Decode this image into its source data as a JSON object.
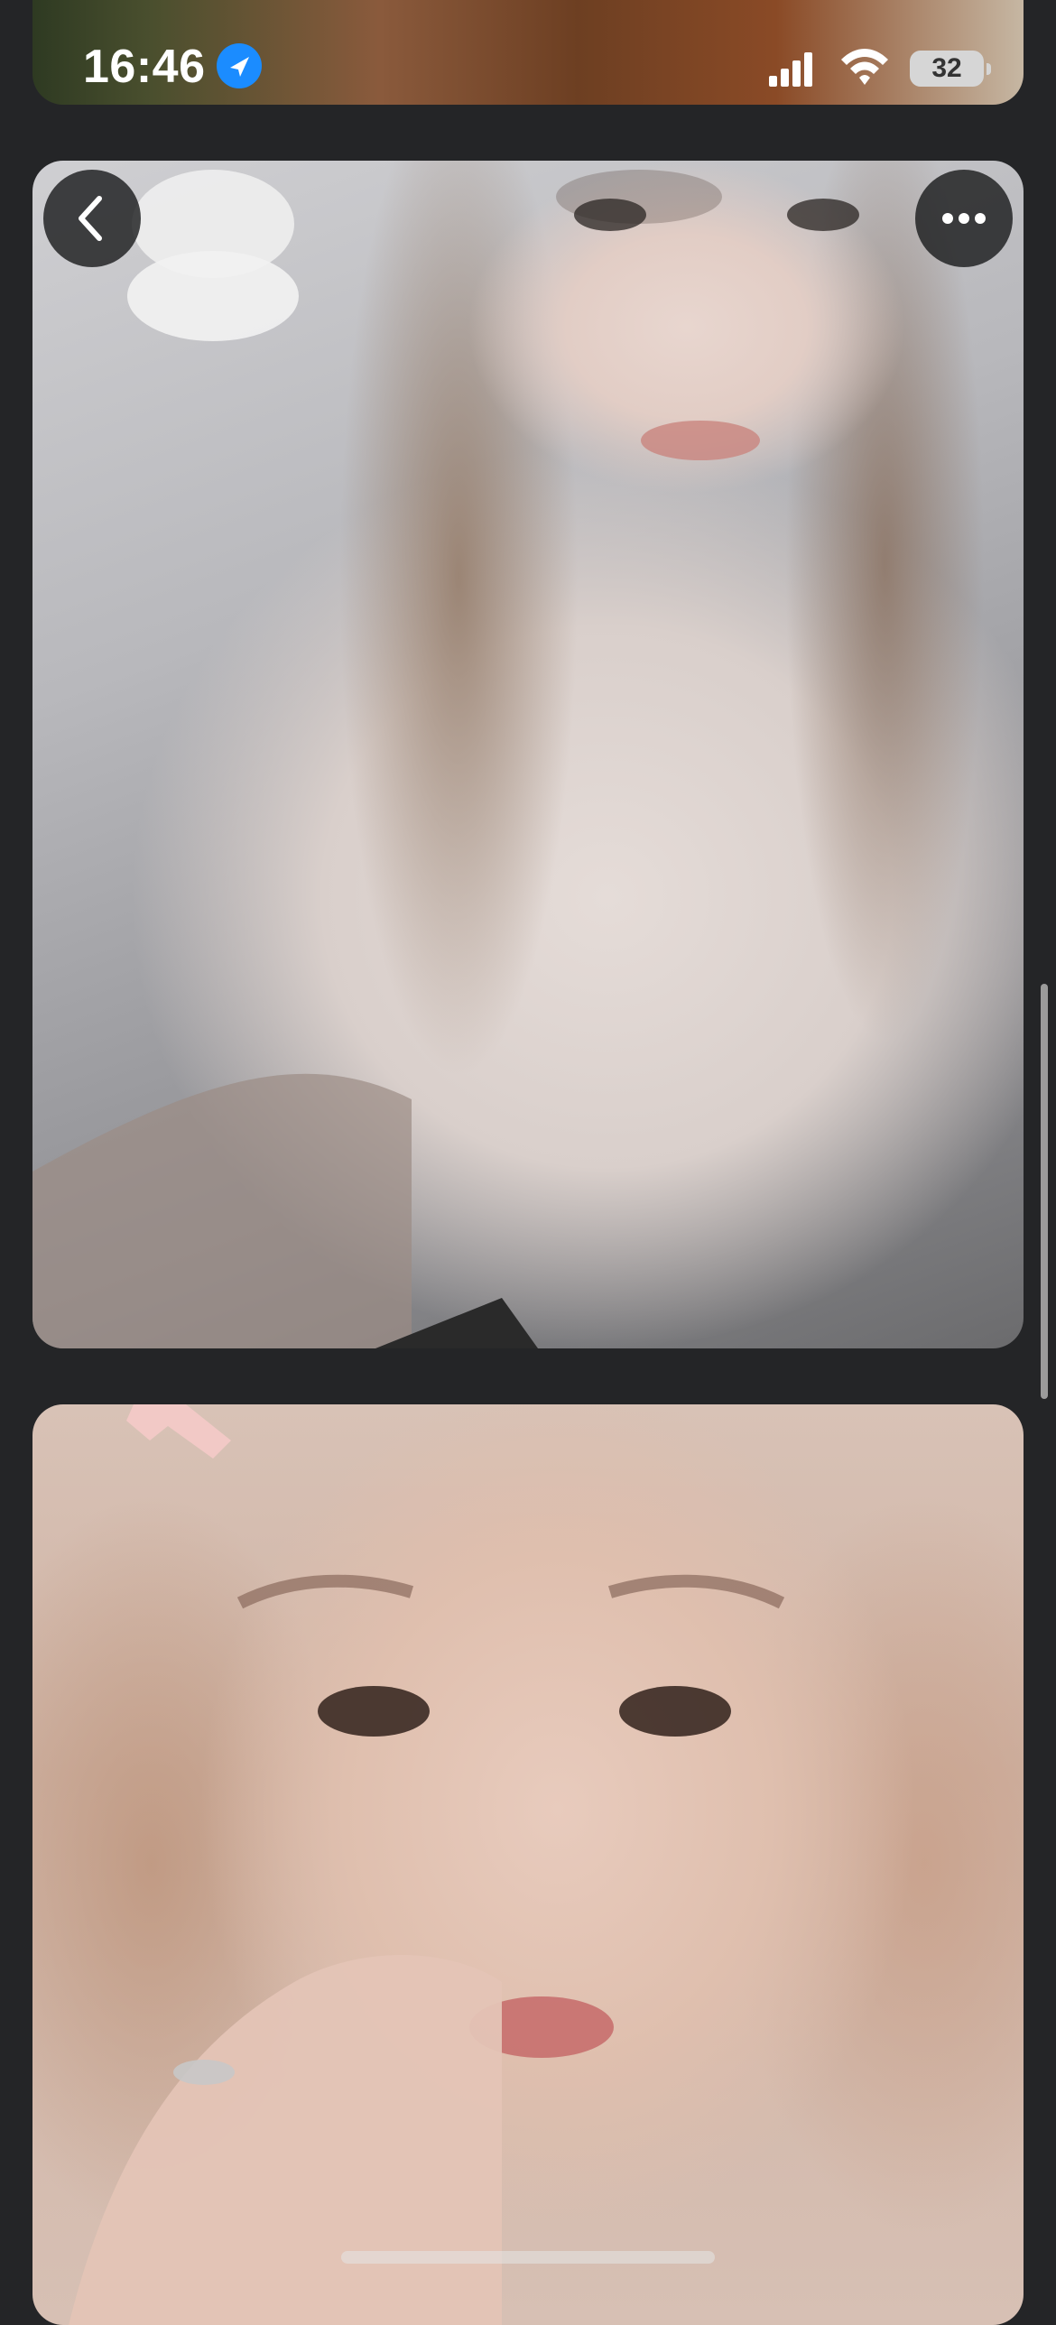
{
  "status_bar": {
    "time": "16:46",
    "battery_level": "32",
    "icons": [
      "location-arrow-icon",
      "cellular-signal-icon",
      "wifi-icon",
      "battery-icon"
    ]
  },
  "toolbar": {
    "back_icon": "chevron-left-icon",
    "more_icon": "more-horizontal-icon"
  },
  "colors": {
    "background": "#242527",
    "button_background": "#1c1d1e",
    "location_blue": "#1b8cff"
  }
}
